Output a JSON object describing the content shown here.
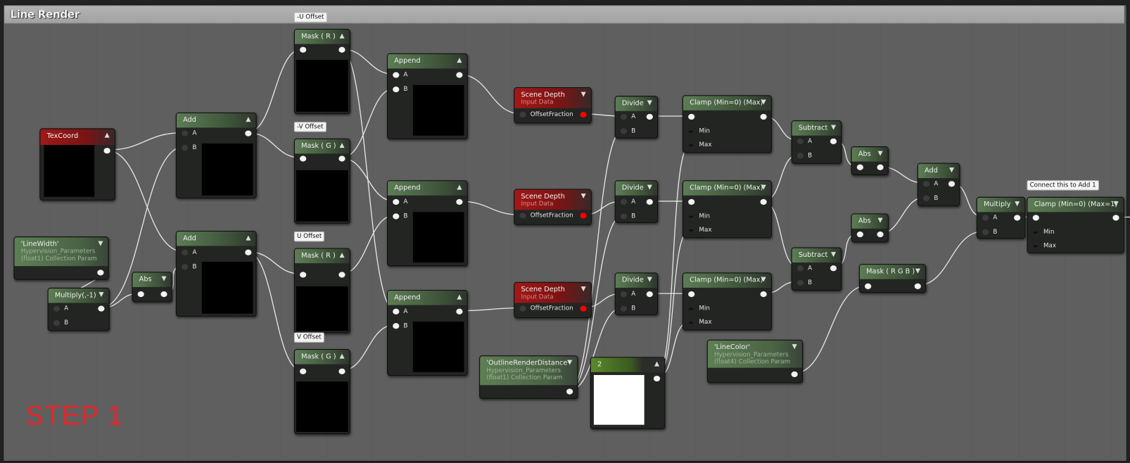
{
  "title": "Line Render",
  "annotation": "STEP 1",
  "nodes": [
    {
      "id": "texcoord",
      "title": "TexCoord",
      "style": "red",
      "collapse": "up",
      "inputs": [],
      "out": "on",
      "preview": "#000"
    },
    {
      "id": "linewidth",
      "title": "'LineWidth'",
      "subtitle": "Hypervision_Parameters (float1) Collection Param",
      "style": "param",
      "collapse": "down",
      "inputs": [],
      "out": "on"
    },
    {
      "id": "mul1",
      "title": "Multiply(,-1)",
      "style": "green",
      "collapse": "down",
      "inputs": [
        "A",
        "B"
      ],
      "out": "on"
    },
    {
      "id": "abs1",
      "title": "Abs",
      "style": "green",
      "collapse": "down",
      "inputs": [
        ""
      ],
      "out": "on"
    },
    {
      "id": "add1",
      "title": "Add",
      "style": "green",
      "collapse": "up",
      "inputs": [
        "A",
        "B"
      ],
      "out": "on",
      "preview": "#000"
    },
    {
      "id": "add2",
      "title": "Add",
      "style": "green",
      "collapse": "up",
      "inputs": [
        "A",
        "B"
      ],
      "out": "on",
      "preview": "#000"
    },
    {
      "id": "mask1",
      "title": "Mask ( R )",
      "comment": "-U Offset",
      "style": "green",
      "collapse": "up",
      "inputs": [
        ""
      ],
      "out": "on",
      "preview": "#000"
    },
    {
      "id": "mask2",
      "title": "Mask ( G )",
      "comment": "-V Offset",
      "style": "green",
      "collapse": "up",
      "inputs": [
        ""
      ],
      "out": "on",
      "preview": "#000"
    },
    {
      "id": "mask3",
      "title": "Mask ( R )",
      "comment": "U Offset",
      "style": "green",
      "collapse": "up",
      "inputs": [
        ""
      ],
      "out": "on",
      "preview": "#000"
    },
    {
      "id": "mask4",
      "title": "Mask ( G )",
      "comment": "V Offset",
      "style": "green",
      "collapse": "up",
      "inputs": [
        ""
      ],
      "out": "on",
      "preview": "#000"
    },
    {
      "id": "append1",
      "title": "Append",
      "style": "green",
      "collapse": "up",
      "inputs": [
        "A",
        "B"
      ],
      "inputStyle": "on",
      "out": "on",
      "preview": "#000"
    },
    {
      "id": "append2",
      "title": "Append",
      "style": "green",
      "collapse": "up",
      "inputs": [
        "A",
        "B"
      ],
      "inputStyle": "on",
      "out": "on",
      "preview": "#000"
    },
    {
      "id": "append3",
      "title": "Append",
      "style": "green",
      "collapse": "up",
      "inputs": [
        "A",
        "B"
      ],
      "inputStyle": "on",
      "out": "on",
      "preview": "#000"
    },
    {
      "id": "sd1",
      "title": "Scene Depth",
      "subtitle": "Input Data",
      "style": "red",
      "collapse": "down",
      "inputs": [
        "OffsetFraction"
      ],
      "out": "red"
    },
    {
      "id": "sd2",
      "title": "Scene Depth",
      "subtitle": "Input Data",
      "style": "red",
      "collapse": "down",
      "inputs": [
        "OffsetFraction"
      ],
      "out": "red"
    },
    {
      "id": "sd3",
      "title": "Scene Depth",
      "subtitle": "Input Data",
      "style": "red",
      "collapse": "down",
      "inputs": [
        "OffsetFraction"
      ],
      "out": "red"
    },
    {
      "id": "div1",
      "title": "Divide",
      "style": "green",
      "collapse": "down",
      "inputs": [
        "A",
        "B"
      ],
      "out": "on"
    },
    {
      "id": "div2",
      "title": "Divide",
      "style": "green",
      "collapse": "down",
      "inputs": [
        "A",
        "B"
      ],
      "out": "on"
    },
    {
      "id": "div3",
      "title": "Divide",
      "style": "green",
      "collapse": "down",
      "inputs": [
        "A",
        "B"
      ],
      "out": "on"
    },
    {
      "id": "ord",
      "title": "'OutlineRenderDistance'",
      "subtitle": "Hypervision_Parameters (float1) Collection Param",
      "style": "param",
      "collapse": "down",
      "inputs": [],
      "out": "on"
    },
    {
      "id": "const2",
      "title": "2",
      "style": "const",
      "collapse": "up",
      "inputs": [],
      "out": "on",
      "preview": "#fff"
    },
    {
      "id": "clamp1",
      "title": "Clamp (Min=0) (Max)",
      "style": "green",
      "collapse": "down",
      "inputs": [
        "",
        "Min",
        "Max"
      ],
      "out": "on"
    },
    {
      "id": "clamp2",
      "title": "Clamp (Min=0) (Max)",
      "style": "green",
      "collapse": "down",
      "inputs": [
        "",
        "Min",
        "Max"
      ],
      "out": "on"
    },
    {
      "id": "clamp3",
      "title": "Clamp (Min=0) (Max)",
      "style": "green",
      "collapse": "down",
      "inputs": [
        "",
        "Min",
        "Max"
      ],
      "out": "on"
    },
    {
      "id": "linecolor",
      "title": "'LineColor'",
      "subtitle": "Hypervision_Parameters (float4) Collection Param",
      "style": "param",
      "collapse": "down",
      "inputs": [],
      "out": "on"
    },
    {
      "id": "sub1",
      "title": "Subtract",
      "style": "green",
      "collapse": "down",
      "inputs": [
        "A",
        "B"
      ],
      "out": "on"
    },
    {
      "id": "sub2",
      "title": "Subtract",
      "style": "green",
      "collapse": "down",
      "inputs": [
        "A",
        "B"
      ],
      "out": "on"
    },
    {
      "id": "abs2",
      "title": "Abs",
      "style": "green",
      "collapse": "down",
      "inputs": [
        ""
      ],
      "out": "on"
    },
    {
      "id": "abs3",
      "title": "Abs",
      "style": "green",
      "collapse": "down",
      "inputs": [
        ""
      ],
      "out": "on"
    },
    {
      "id": "add3",
      "title": "Add",
      "style": "green",
      "collapse": "down",
      "inputs": [
        "A",
        "B"
      ],
      "out": "on"
    },
    {
      "id": "maskrgb",
      "title": "Mask ( R G B )",
      "style": "green",
      "collapse": "down",
      "inputs": [
        ""
      ],
      "out": "on"
    },
    {
      "id": "mul2",
      "title": "Multiply",
      "style": "green",
      "collapse": "down",
      "inputs": [
        "A",
        "B"
      ],
      "out": "on"
    },
    {
      "id": "clamp4",
      "title": "Clamp (Min=0) (Max=1)",
      "comment": "Connect this to Add 1",
      "style": "green",
      "collapse": "down",
      "inputs": [
        "",
        "Min",
        "Max"
      ],
      "out": "on"
    }
  ],
  "connections": [
    [
      "texcoord",
      "add1:0"
    ],
    [
      "texcoord",
      "add2:0"
    ],
    [
      "linewidth",
      "mul1:0"
    ],
    [
      "mul1",
      "add1:1"
    ],
    [
      "mul1",
      "abs1:0"
    ],
    [
      "abs1",
      "add2:1"
    ],
    [
      "add1",
      "mask1:0"
    ],
    [
      "add1",
      "mask2:0"
    ],
    [
      "add2",
      "mask3:0"
    ],
    [
      "add2",
      "mask4:0"
    ],
    [
      "mask1",
      "append1:0"
    ],
    [
      "mask2",
      "append1:1"
    ],
    [
      "mask2",
      "append2:0"
    ],
    [
      "mask3",
      "append2:1"
    ],
    [
      "mask1",
      "append3:0"
    ],
    [
      "mask4",
      "append3:1"
    ],
    [
      "append1",
      "sd1:0"
    ],
    [
      "append2",
      "sd2:0"
    ],
    [
      "append3",
      "sd3:0"
    ],
    [
      "sd1",
      "div1:0"
    ],
    [
      "sd2",
      "div2:0"
    ],
    [
      "sd3",
      "div3:0"
    ],
    [
      "ord",
      "div1:1"
    ],
    [
      "ord",
      "div2:1"
    ],
    [
      "ord",
      "div3:1"
    ],
    [
      "div1",
      "clamp1:0"
    ],
    [
      "div2",
      "clamp2:0"
    ],
    [
      "div3",
      "clamp3:0"
    ],
    [
      "const2",
      "clamp1:2"
    ],
    [
      "const2",
      "clamp2:2"
    ],
    [
      "const2",
      "clamp3:2"
    ],
    [
      "clamp1",
      "sub1:0"
    ],
    [
      "clamp2",
      "sub1:1"
    ],
    [
      "clamp2",
      "sub2:0"
    ],
    [
      "clamp3",
      "sub2:1"
    ],
    [
      "sub1",
      "abs2:0"
    ],
    [
      "sub2",
      "abs3:0"
    ],
    [
      "abs2",
      "add3:0"
    ],
    [
      "abs3",
      "add3:1"
    ],
    [
      "add3",
      "mul2:0"
    ],
    [
      "linecolor",
      "maskrgb:0"
    ],
    [
      "maskrgb",
      "mul2:1"
    ],
    [
      "mul2",
      "clamp4:0"
    ],
    [
      "clamp4",
      "offscreen"
    ]
  ]
}
